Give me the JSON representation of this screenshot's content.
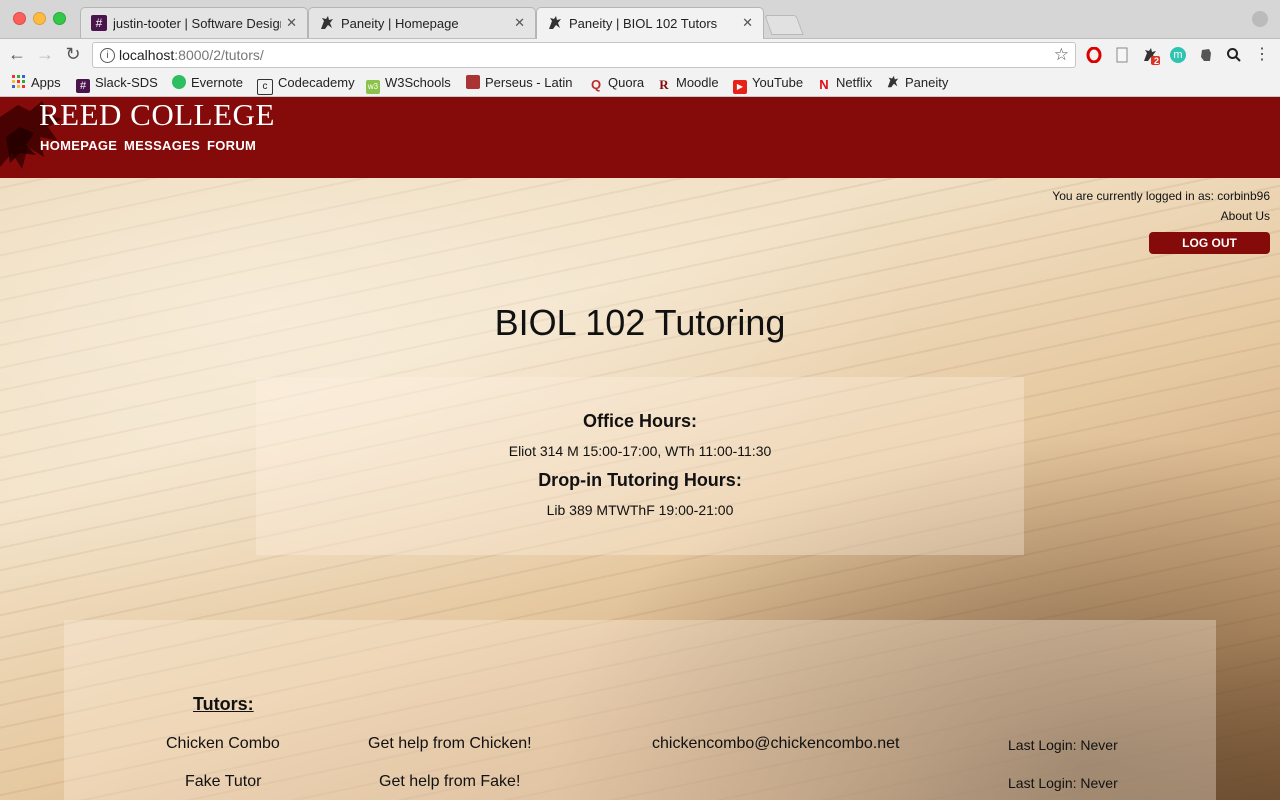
{
  "browser": {
    "tabs": [
      {
        "title": "justin-tooter | Software Design",
        "favicon": "#",
        "close": "✕"
      },
      {
        "title": "Paneity | Homepage",
        "favicon": "griffin",
        "close": "✕"
      },
      {
        "title": "Paneity | BIOL 102 Tutors",
        "favicon": "griffin",
        "close": "✕"
      }
    ],
    "url_host": "localhost",
    "url_path": ":8000/2/tutors/",
    "bookmarks": [
      {
        "label": "Apps",
        "icon": "apps-grid"
      },
      {
        "label": "Slack-SDS",
        "icon": "#"
      },
      {
        "label": "Evernote",
        "icon": "evernote"
      },
      {
        "label": "Codecademy",
        "icon": "c"
      },
      {
        "label": "W3Schools",
        "icon": "w3"
      },
      {
        "label": "Perseus - Latin",
        "icon": "perseus"
      },
      {
        "label": "Quora",
        "icon": "Q"
      },
      {
        "label": "Moodle",
        "icon": "R"
      },
      {
        "label": "YouTube",
        "icon": "▶"
      },
      {
        "label": "Netflix",
        "icon": "N"
      },
      {
        "label": "Paneity",
        "icon": "griffin"
      }
    ],
    "extension_badge": "2",
    "ext_letter": "m",
    "colors": {
      "accent": "#850a0a"
    }
  },
  "header": {
    "site_title": "REED COLLEGE",
    "nav": [
      "HOMEPAGE",
      "MESSAGES",
      "FORUM"
    ]
  },
  "user": {
    "logged_in_text": "You are currently logged in as: corbinb96",
    "about_label": "About Us",
    "logout_label": "LOG OUT"
  },
  "main": {
    "title": "BIOL 102 Tutoring",
    "office_hours_heading": "Office Hours:",
    "office_hours": "Eliot 314 M 15:00-17:00, WTh 11:00-11:30",
    "dropin_heading": "Drop-in Tutoring Hours:",
    "dropin_hours": "Lib 389 MTWThF 19:00-21:00",
    "tutors_heading": "Tutors:",
    "tutors": [
      {
        "name": "Chicken Combo",
        "help": "Get help from Chicken!",
        "email": "chickencombo@chickencombo.net",
        "last_login": "Last Login: Never"
      },
      {
        "name": "Fake Tutor",
        "help": "Get help from Fake!",
        "email": "",
        "last_login": "Last Login: Never"
      }
    ]
  }
}
